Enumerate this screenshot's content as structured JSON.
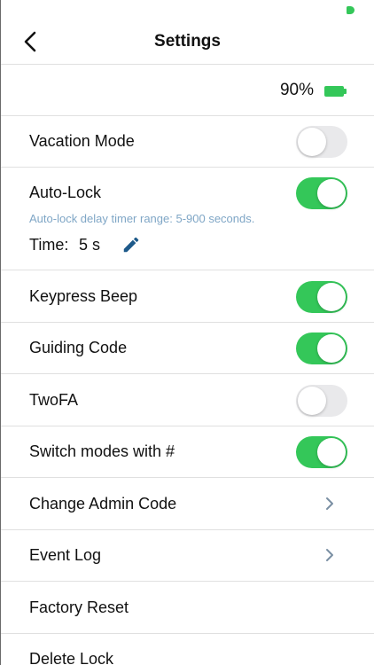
{
  "header": {
    "title": "Settings",
    "back_icon": "chevron-left-icon"
  },
  "battery": {
    "percent": "90%",
    "color": "#34c759"
  },
  "colors": {
    "toggle_on": "#34c759",
    "toggle_off": "#e9e9eb",
    "hint": "#7fa6c6",
    "accent": "#1e5a8a"
  },
  "settings": {
    "vacation_mode": {
      "label": "Vacation Mode",
      "enabled": false
    },
    "auto_lock": {
      "label": "Auto-Lock",
      "enabled": true,
      "hint": "Auto-lock delay timer range: 5-900 seconds.",
      "time_label": "Time:",
      "time_value": "5 s"
    },
    "keypress_beep": {
      "label": "Keypress Beep",
      "enabled": true
    },
    "guiding_code": {
      "label": "Guiding Code",
      "enabled": true
    },
    "twofa": {
      "label": "TwoFA",
      "enabled": false
    },
    "switch_modes": {
      "label": "Switch modes with #",
      "enabled": true
    },
    "change_admin_code": {
      "label": "Change Admin Code"
    },
    "event_log": {
      "label": "Event Log"
    },
    "factory_reset": {
      "label": "Factory Reset"
    },
    "delete_lock": {
      "label": "Delete Lock"
    }
  }
}
